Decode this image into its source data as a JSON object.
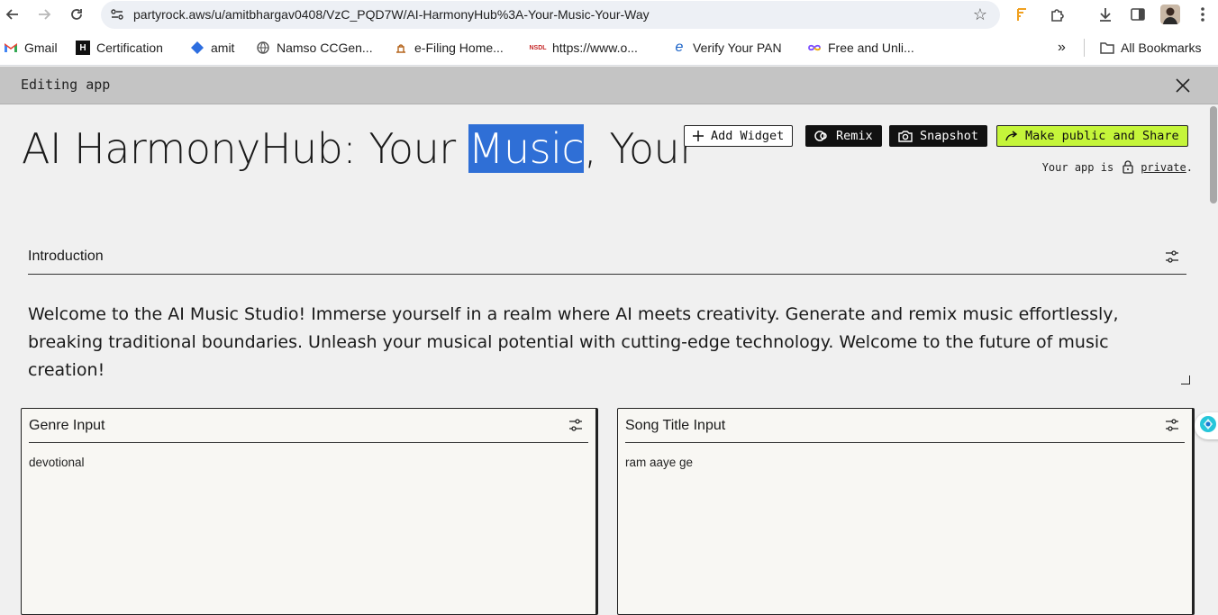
{
  "browser": {
    "url": "partyrock.aws/u/amitbhargav0408/VzC_PQD7W/AI-HarmonyHub%3A-Your-Music-Your-Way",
    "bookmarks": [
      {
        "label": "Gmail",
        "icon": "gmail-icon"
      },
      {
        "label": "Certification",
        "icon": "hackerrank-icon"
      },
      {
        "label": "amit",
        "icon": "diamond-icon"
      },
      {
        "label": "Namso CCGen...",
        "icon": "globe-icon"
      },
      {
        "label": "e-Filing Home...",
        "icon": "emblem-icon"
      },
      {
        "label": "https://www.o...",
        "icon": "nsdl-icon"
      },
      {
        "label": "Verify Your PAN",
        "icon": "edge-e-icon"
      },
      {
        "label": "Free and Unli...",
        "icon": "infinity-icon"
      }
    ],
    "all_bookmarks_label": "All Bookmarks"
  },
  "edit_bar": {
    "label": "Editing app"
  },
  "app": {
    "title_before": "AI HarmonyHub: Your ",
    "title_selected": "Music",
    "title_after": ", Your",
    "buttons": {
      "add_widget": "Add Widget",
      "remix": "Remix",
      "snapshot": "Snapshot",
      "share": "Make public and Share"
    },
    "privacy_prefix": "Your app is",
    "privacy_link": "private",
    "privacy_suffix": "."
  },
  "introduction": {
    "title": "Introduction",
    "text": "Welcome to the AI Music Studio! Immerse yourself in a realm where AI meets creativity. Generate and remix music effortlessly, breaking traditional boundaries. Unleash your musical potential with cutting-edge technology. Welcome to the future of music creation!"
  },
  "widgets": [
    {
      "title": "Genre Input",
      "value": "devotional"
    },
    {
      "title": "Song Title Input",
      "value": "ram aaye ge"
    }
  ],
  "colors": {
    "selection": "#2f6fd6",
    "share_button": "#c5f53a",
    "dark_button": "#111111"
  }
}
